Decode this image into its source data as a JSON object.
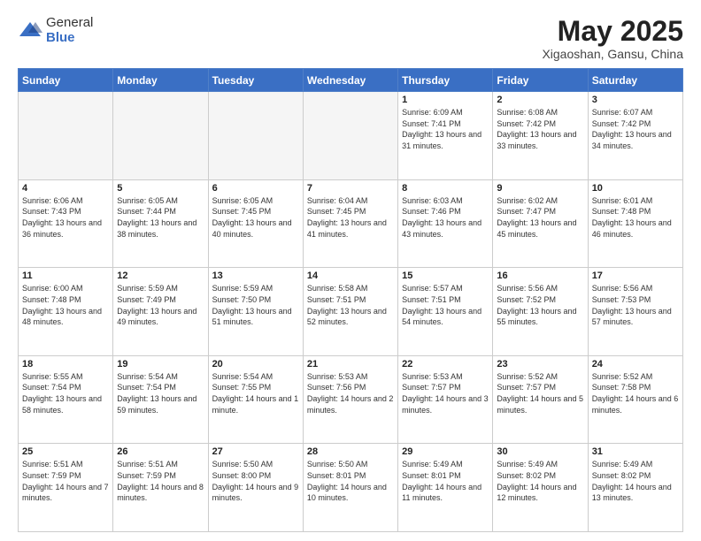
{
  "header": {
    "logo_general": "General",
    "logo_blue": "Blue",
    "month_title": "May 2025",
    "subtitle": "Xigaoshan, Gansu, China"
  },
  "weekdays": [
    "Sunday",
    "Monday",
    "Tuesday",
    "Wednesday",
    "Thursday",
    "Friday",
    "Saturday"
  ],
  "weeks": [
    [
      {
        "day": "",
        "empty": true
      },
      {
        "day": "",
        "empty": true
      },
      {
        "day": "",
        "empty": true
      },
      {
        "day": "",
        "empty": true
      },
      {
        "day": "1",
        "info": "Sunrise: 6:09 AM\nSunset: 7:41 PM\nDaylight: 13 hours\nand 31 minutes."
      },
      {
        "day": "2",
        "info": "Sunrise: 6:08 AM\nSunset: 7:42 PM\nDaylight: 13 hours\nand 33 minutes."
      },
      {
        "day": "3",
        "info": "Sunrise: 6:07 AM\nSunset: 7:42 PM\nDaylight: 13 hours\nand 34 minutes."
      }
    ],
    [
      {
        "day": "4",
        "info": "Sunrise: 6:06 AM\nSunset: 7:43 PM\nDaylight: 13 hours\nand 36 minutes."
      },
      {
        "day": "5",
        "info": "Sunrise: 6:05 AM\nSunset: 7:44 PM\nDaylight: 13 hours\nand 38 minutes."
      },
      {
        "day": "6",
        "info": "Sunrise: 6:05 AM\nSunset: 7:45 PM\nDaylight: 13 hours\nand 40 minutes."
      },
      {
        "day": "7",
        "info": "Sunrise: 6:04 AM\nSunset: 7:45 PM\nDaylight: 13 hours\nand 41 minutes."
      },
      {
        "day": "8",
        "info": "Sunrise: 6:03 AM\nSunset: 7:46 PM\nDaylight: 13 hours\nand 43 minutes."
      },
      {
        "day": "9",
        "info": "Sunrise: 6:02 AM\nSunset: 7:47 PM\nDaylight: 13 hours\nand 45 minutes."
      },
      {
        "day": "10",
        "info": "Sunrise: 6:01 AM\nSunset: 7:48 PM\nDaylight: 13 hours\nand 46 minutes."
      }
    ],
    [
      {
        "day": "11",
        "info": "Sunrise: 6:00 AM\nSunset: 7:48 PM\nDaylight: 13 hours\nand 48 minutes."
      },
      {
        "day": "12",
        "info": "Sunrise: 5:59 AM\nSunset: 7:49 PM\nDaylight: 13 hours\nand 49 minutes."
      },
      {
        "day": "13",
        "info": "Sunrise: 5:59 AM\nSunset: 7:50 PM\nDaylight: 13 hours\nand 51 minutes."
      },
      {
        "day": "14",
        "info": "Sunrise: 5:58 AM\nSunset: 7:51 PM\nDaylight: 13 hours\nand 52 minutes."
      },
      {
        "day": "15",
        "info": "Sunrise: 5:57 AM\nSunset: 7:51 PM\nDaylight: 13 hours\nand 54 minutes."
      },
      {
        "day": "16",
        "info": "Sunrise: 5:56 AM\nSunset: 7:52 PM\nDaylight: 13 hours\nand 55 minutes."
      },
      {
        "day": "17",
        "info": "Sunrise: 5:56 AM\nSunset: 7:53 PM\nDaylight: 13 hours\nand 57 minutes."
      }
    ],
    [
      {
        "day": "18",
        "info": "Sunrise: 5:55 AM\nSunset: 7:54 PM\nDaylight: 13 hours\nand 58 minutes."
      },
      {
        "day": "19",
        "info": "Sunrise: 5:54 AM\nSunset: 7:54 PM\nDaylight: 13 hours\nand 59 minutes."
      },
      {
        "day": "20",
        "info": "Sunrise: 5:54 AM\nSunset: 7:55 PM\nDaylight: 14 hours\nand 1 minute."
      },
      {
        "day": "21",
        "info": "Sunrise: 5:53 AM\nSunset: 7:56 PM\nDaylight: 14 hours\nand 2 minutes."
      },
      {
        "day": "22",
        "info": "Sunrise: 5:53 AM\nSunset: 7:57 PM\nDaylight: 14 hours\nand 3 minutes."
      },
      {
        "day": "23",
        "info": "Sunrise: 5:52 AM\nSunset: 7:57 PM\nDaylight: 14 hours\nand 5 minutes."
      },
      {
        "day": "24",
        "info": "Sunrise: 5:52 AM\nSunset: 7:58 PM\nDaylight: 14 hours\nand 6 minutes."
      }
    ],
    [
      {
        "day": "25",
        "info": "Sunrise: 5:51 AM\nSunset: 7:59 PM\nDaylight: 14 hours\nand 7 minutes."
      },
      {
        "day": "26",
        "info": "Sunrise: 5:51 AM\nSunset: 7:59 PM\nDaylight: 14 hours\nand 8 minutes."
      },
      {
        "day": "27",
        "info": "Sunrise: 5:50 AM\nSunset: 8:00 PM\nDaylight: 14 hours\nand 9 minutes."
      },
      {
        "day": "28",
        "info": "Sunrise: 5:50 AM\nSunset: 8:01 PM\nDaylight: 14 hours\nand 10 minutes."
      },
      {
        "day": "29",
        "info": "Sunrise: 5:49 AM\nSunset: 8:01 PM\nDaylight: 14 hours\nand 11 minutes."
      },
      {
        "day": "30",
        "info": "Sunrise: 5:49 AM\nSunset: 8:02 PM\nDaylight: 14 hours\nand 12 minutes."
      },
      {
        "day": "31",
        "info": "Sunrise: 5:49 AM\nSunset: 8:02 PM\nDaylight: 14 hours\nand 13 minutes."
      }
    ]
  ]
}
